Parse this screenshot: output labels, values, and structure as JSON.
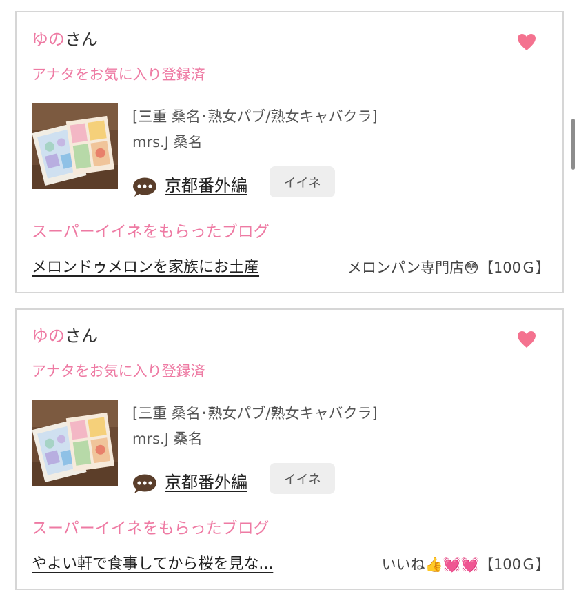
{
  "colors": {
    "accent_pink": "#ee7aa3",
    "heart": "#f4728f",
    "chat_bubble": "#5a3e2b",
    "button_bg": "#eeeeee",
    "card_border": "#d6d6d6"
  },
  "cards": [
    {
      "user_name": "ゆの",
      "user_suffix": "さん",
      "heart_icon": "heart-icon",
      "fav_status": "アナタをお気に入り登録済",
      "thumbnail": "shop-photo",
      "shop_category": "[三重 桑名･熟女パブ/熟女キャバクラ]",
      "shop_name": "mrs.J 桑名",
      "blog_title": "京都番外編",
      "iine_label": "イイネ",
      "super_heading": "スーパーイイネをもらったブログ",
      "super_link": "メロンドゥメロンを家族にお土産",
      "super_meta": "メロンパン専門店😳【100Ｇ】"
    },
    {
      "user_name": "ゆの",
      "user_suffix": "さん",
      "heart_icon": "heart-icon",
      "fav_status": "アナタをお気に入り登録済",
      "thumbnail": "shop-photo",
      "shop_category": "[三重 桑名･熟女パブ/熟女キャバクラ]",
      "shop_name": "mrs.J 桑名",
      "blog_title": "京都番外編",
      "iine_label": "イイネ",
      "super_heading": "スーパーイイネをもらったブログ",
      "super_link": "やよい軒で食事してから桜を見な...",
      "super_meta": "いいね👍💓💓【100Ｇ】"
    }
  ]
}
